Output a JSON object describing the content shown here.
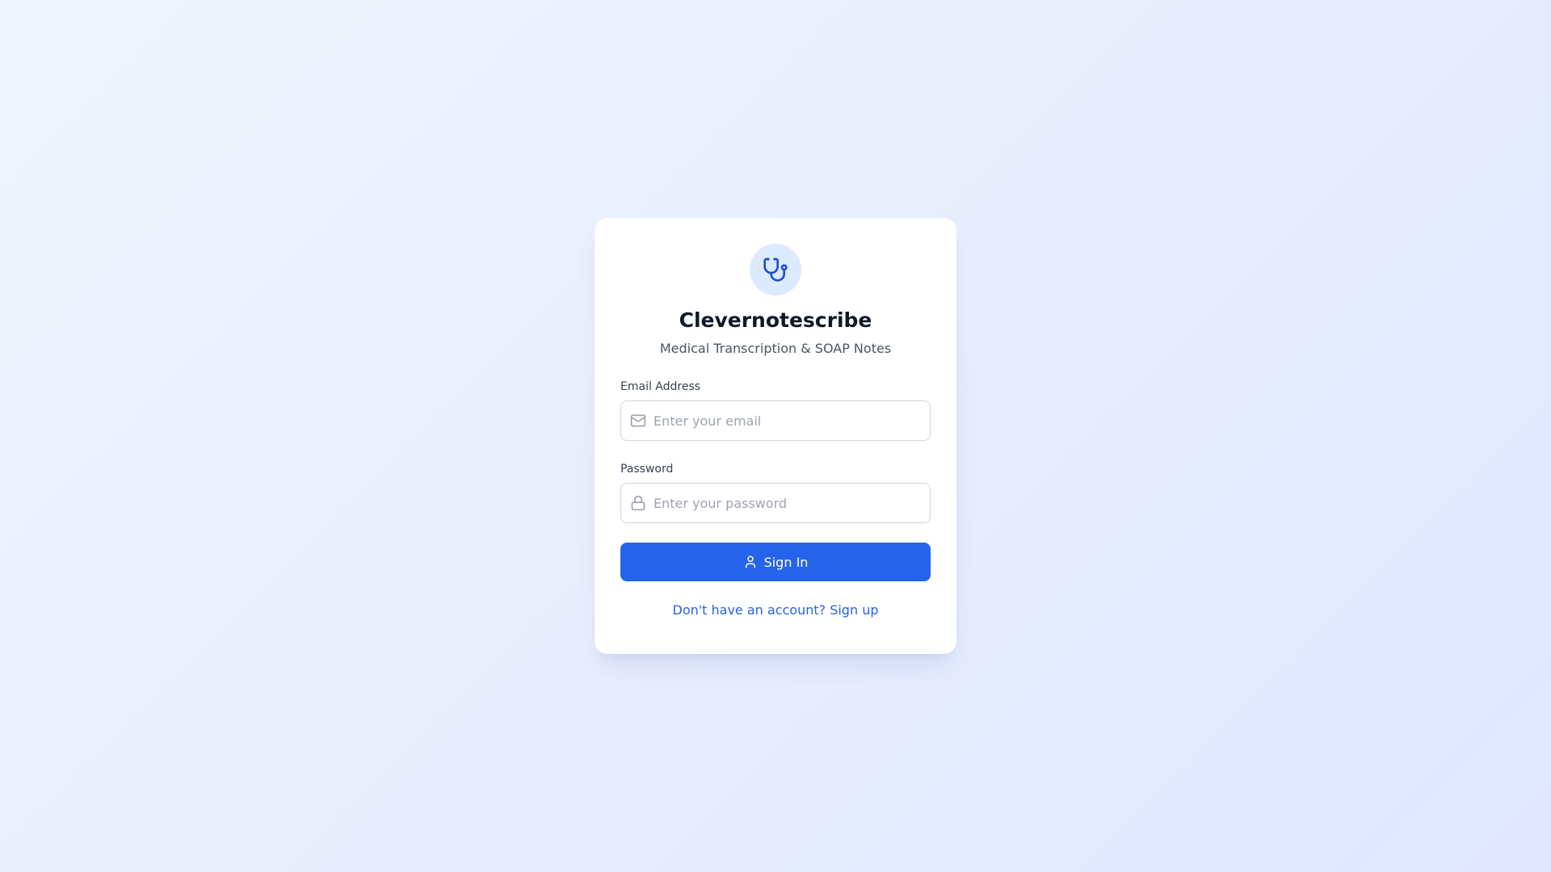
{
  "app": {
    "title": "Clevernotescribe",
    "subtitle": "Medical Transcription & SOAP Notes",
    "logo_icon": "stethoscope-icon"
  },
  "form": {
    "email": {
      "label": "Email Address",
      "placeholder": "Enter your email",
      "value": "",
      "icon": "mail-icon"
    },
    "password": {
      "label": "Password",
      "placeholder": "Enter your password",
      "value": "",
      "icon": "lock-icon"
    },
    "submit": {
      "label": "Sign In",
      "icon": "user-icon"
    }
  },
  "signup_link": "Don't have an account? Sign up",
  "colors": {
    "accent": "#2563eb",
    "logo_bg": "#dbeafe",
    "title": "#111827",
    "muted": "#4b5563"
  }
}
